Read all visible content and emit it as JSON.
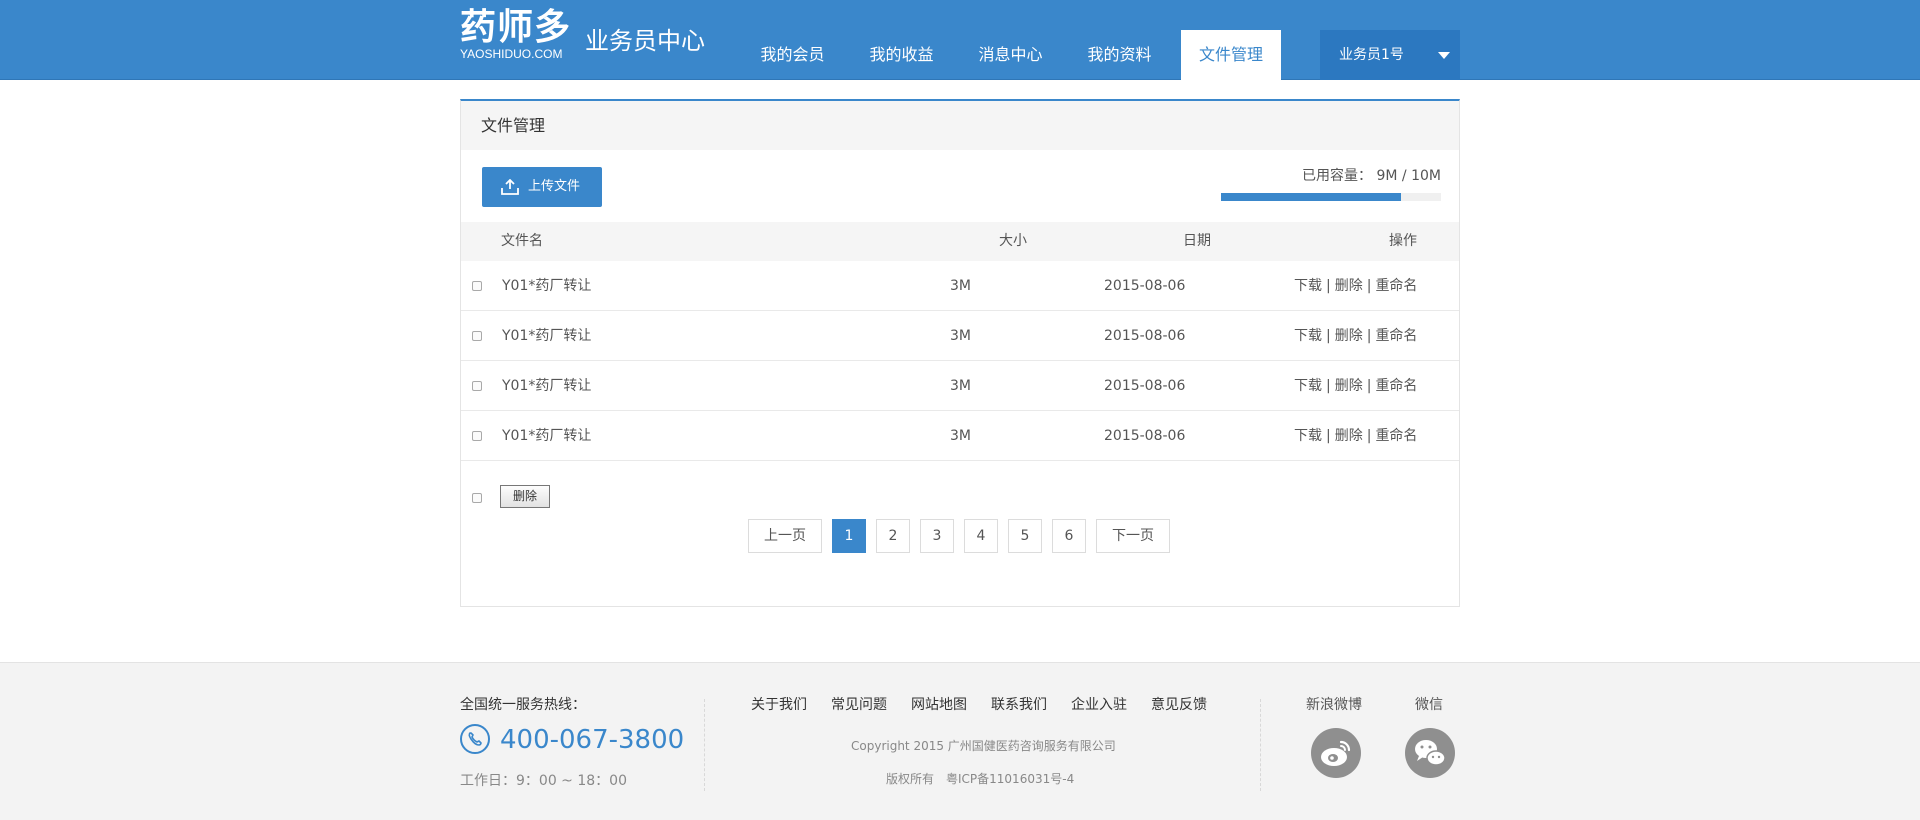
{
  "header": {
    "logo_cn": "药师多",
    "logo_en": "YAOSHIDUO.COM",
    "subtitle": "业务员中心",
    "nav": [
      {
        "label": "我的会员"
      },
      {
        "label": "我的收益"
      },
      {
        "label": "消息中心"
      },
      {
        "label": "我的资料"
      },
      {
        "label": "文件管理",
        "active": true
      }
    ],
    "user": "业务员1号"
  },
  "panel": {
    "title": "文件管理",
    "upload_label": "上传文件",
    "capacity_label": "已用容量：",
    "capacity_value": "9M / 10M",
    "capacity_used_fraction": 0.82,
    "columns": {
      "name": "文件名",
      "size": "大小",
      "date": "日期",
      "ops": "操作"
    },
    "rows": [
      {
        "name": "Y01*药厂转让",
        "size": "3M",
        "date": "2015-08-06",
        "download": "下载",
        "delete": "删除",
        "rename": "重命名"
      },
      {
        "name": "Y01*药厂转让",
        "size": "3M",
        "date": "2015-08-06",
        "download": "下载",
        "delete": "删除",
        "rename": "重命名"
      },
      {
        "name": "Y01*药厂转让",
        "size": "3M",
        "date": "2015-08-06",
        "download": "下载",
        "delete": "删除",
        "rename": "重命名"
      },
      {
        "name": "Y01*药厂转让",
        "size": "3M",
        "date": "2015-08-06",
        "download": "下载",
        "delete": "删除",
        "rename": "重命名"
      }
    ],
    "op_separator": "|",
    "bulk_delete_label": "删除",
    "pager": {
      "prev": "上一页",
      "pages": [
        "1",
        "2",
        "3",
        "4",
        "5",
        "6"
      ],
      "current": "1",
      "next": "下一页"
    }
  },
  "footer": {
    "hotline_title": "全国统一服务热线：",
    "hotline": "400-067-3800",
    "work_time": "工作日：9：00 ~ 18：00",
    "links": [
      "关于我们",
      "常见问题",
      "网站地图",
      "联系我们",
      "企业入驻",
      "意见反馈"
    ],
    "copyright": "Copyright 2015 广州国健医药咨询服务有限公司",
    "icp": "版权所有　粤ICP备11016031号-4",
    "weibo_label": "新浪微博",
    "wechat_label": "微信"
  },
  "colors": {
    "primary": "#3a87cb",
    "footer_bg": "#f3f3f3",
    "icon_gray": "#8f8f8f"
  }
}
